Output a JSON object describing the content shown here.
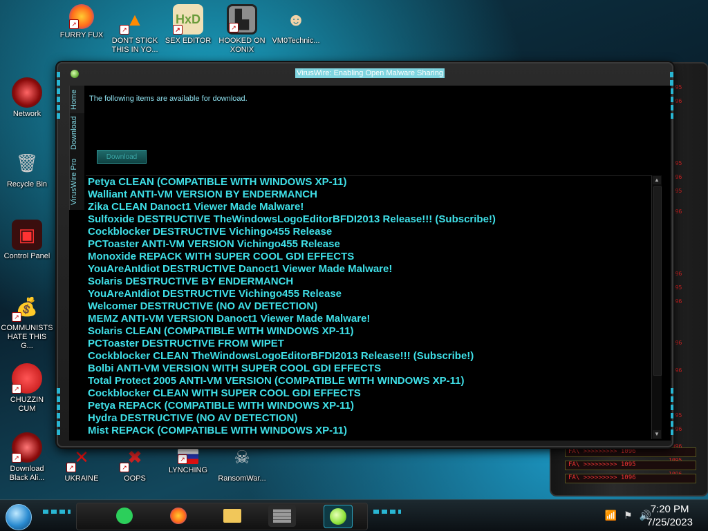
{
  "desktop": {
    "icons": [
      {
        "label": "FURRY FUX",
        "icon": "firefox-icon",
        "color": "#ff6b1a"
      },
      {
        "label": "DONT STICK THIS IN YO...",
        "icon": "vlc-cone-icon",
        "color": "#ff8a00"
      },
      {
        "label": "SEX EDITOR",
        "icon": "hxd-icon",
        "color": "#d8a33c"
      },
      {
        "label": "HOOKED ON XONIX",
        "icon": "xonix-game-icon",
        "color": "#c7c7c7"
      },
      {
        "label": "VM0Technic...",
        "icon": "doctor-avatar-icon",
        "color": "#f1d2a7"
      },
      {
        "label": "Network",
        "icon": "network-icon",
        "color": "#c4141c"
      },
      {
        "label": "Recycle Bin",
        "icon": "recycle-bin-icon",
        "color": "#c8c8c8"
      },
      {
        "label": "Control Panel",
        "icon": "control-panel-icon",
        "color": "#d12a2a"
      },
      {
        "label": "COMMUNISTS HATE THIS G...",
        "icon": "money-bag-icon",
        "color": "#c79a4a"
      },
      {
        "label": "CHUZZIN CUM",
        "icon": "chuzzle-icon",
        "color": "#e02222"
      },
      {
        "label": "Download Black Ali...",
        "icon": "alien-eye-icon",
        "color": "#b01222"
      },
      {
        "label": "UKRAINE",
        "icon": "ukraine-icon",
        "color": "#d11"
      },
      {
        "label": "OOPS",
        "icon": "oops-icon",
        "color": "#aa1111"
      },
      {
        "label": "LYNCHING",
        "icon": "flag-icon",
        "color": "#ffffff"
      },
      {
        "label": "RansomWar...",
        "icon": "skull-icon",
        "color": "#ddd"
      }
    ]
  },
  "window": {
    "title": "VirusWire: Enabling Open Malware Sharing",
    "tabs": [
      "Home",
      "Download",
      "VirusWire Pro"
    ],
    "intro_text": "The following items are available for download.",
    "download_button": "Download",
    "items": [
      "Petya CLEAN (COMPATIBLE WITH WINDOWS XP-11)",
      "Walliant ANTI-VM VERSION BY ENDERMANCH",
      "Zika CLEAN Danoct1 Viewer Made Malware!",
      "Sulfoxide DESTRUCTIVE TheWindowsLogoEditorBFDI2013 Release!!! (Subscribe!)",
      "Cockblocker DESTRUCTIVE Vichingo455 Release",
      "PCToaster ANTI-VM VERSION Vichingo455 Release",
      "Monoxide REPACK WITH SUPER COOL GDI EFFECTS",
      "YouAreAnIdiot DESTRUCTIVE Danoct1 Viewer Made Malware!",
      "Solaris DESTRUCTIVE BY ENDERMANCH",
      "YouAreAnIdiot DESTRUCTIVE Vichingo455 Release",
      "Welcomer DESTRUCTIVE (NO AV DETECTION)",
      "MEMZ ANTI-VM VERSION Danoct1 Viewer Made Malware!",
      "Solaris CLEAN (COMPATIBLE WITH WINDOWS XP-11)",
      "PCToaster DESTRUCTIVE FROM WIPET",
      "Cockblocker CLEAN TheWindowsLogoEditorBFDI2013 Release!!! (Subscribe!)",
      "Bolbi ANTI-VM VERSION WITH SUPER COOL GDI EFFECTS",
      "Total Protect 2005 ANTI-VM VERSION (COMPATIBLE WITH WINDOWS XP-11)",
      "Cockblocker CLEAN WITH SUPER COOL GDI EFFECTS",
      "Petya REPACK (COMPATIBLE WITH WINDOWS XP-11)",
      "Hydra DESTRUCTIVE (NO AV DETECTION)",
      "Mist REPACK (COMPATIBLE WITH WINDOWS XP-11)"
    ]
  },
  "widget": {
    "readouts": [
      "1095",
      "1096",
      "1095",
      "1096",
      "1095",
      "1096",
      "1096",
      "1095",
      "1096",
      "1096",
      "1096",
      "1095",
      "1096",
      "1096",
      "1095",
      "1096"
    ],
    "fa_rows": [
      "FA\\  >>>>>>>>> 1096",
      "FA\\  >>>>>>>>> 1095",
      "FA\\  >>>>>>>>> 1096"
    ]
  },
  "taskbar": {
    "apps": [
      {
        "icon": "spotify-green-icon",
        "color": "#2ccf5b"
      },
      {
        "icon": "firefox-icon",
        "color": "#ff6b1a"
      },
      {
        "icon": "file-explorer-icon",
        "color": "#f1c75a"
      },
      {
        "icon": "brick-wall-icon",
        "color": "#9a9a9a"
      },
      {
        "icon": "lime-orb-icon",
        "color": "#8de23a"
      }
    ],
    "tray": [
      "📶",
      "⚑",
      "🔊"
    ],
    "clock_time": "7:20 PM",
    "clock_date": "7/25/2023"
  }
}
